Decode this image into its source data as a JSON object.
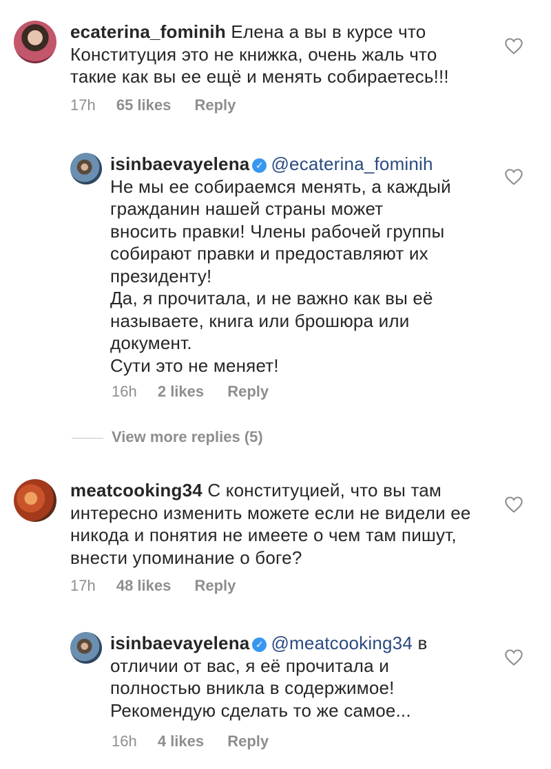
{
  "comments": [
    {
      "username": "ecaterina_fominih",
      "text": "Елена а вы в курсе что Конституция это не книжка, очень жаль что такие как вы ее ещё и менять собираетесь!!!",
      "time": "17h",
      "likes": "65 likes",
      "reply": "Reply"
    },
    {
      "username": "isinbaevayelena",
      "mention": "@ecaterina_fominih",
      "text_lines": [
        "Не мы ее собираемся менять, а каждый",
        "гражданин нашей страны может",
        "вносить правки! Члены рабочей группы",
        "собирают правки и предоставляют их",
        "президенту!",
        "Да, я прочитала, и не важно как вы её",
        "называете, книга или брошюра или",
        "документ.",
        "Сути это не меняет!"
      ],
      "time": "16h",
      "likes": "2 likes",
      "reply": "Reply"
    },
    {
      "username": "meatcooking34",
      "text": "С конституцией, что вы там интересно изменить можете если не видели ее никода и понятия не имеете о чем там пишут, внести упоминание о боге?",
      "time": "17h",
      "likes": "48 likes",
      "reply": "Reply"
    },
    {
      "username": "isinbaevayelena",
      "mention": "@meatcooking34",
      "mention_tail": "в",
      "text_lines": [
        "отличии от вас, я её прочитала и",
        "полностью вникла в содержимое!",
        "Рекомендую сделать то же самое..."
      ],
      "time": "16h",
      "likes": "4 likes",
      "reply": "Reply"
    }
  ],
  "view_more": "View more replies (5)",
  "icons": {
    "like": "heart-outline-icon",
    "verified": "verified-badge-icon"
  },
  "colors": {
    "text": "#262626",
    "muted": "#8e8e8e",
    "mention": "#2a4a80",
    "verified": "#3897f0"
  }
}
